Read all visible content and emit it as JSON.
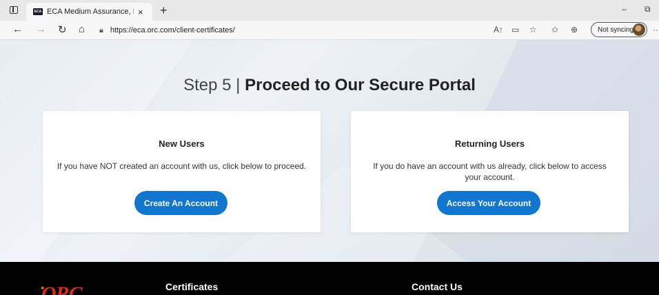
{
  "browser": {
    "tab_title": "ECA Medium Assurance, ECA Me",
    "favicon_text": "ECA",
    "tab_close": "×",
    "new_tab": "+",
    "minimize": "–",
    "restore": "⧉",
    "url": "https://eca.orc.com/client-certificates/",
    "sync_label": "Not syncing",
    "more": "···"
  },
  "page": {
    "step_prefix": "Step 5 | ",
    "step_title": "Proceed to Our Secure Portal",
    "new_users": {
      "title": "New Users",
      "text": "If you have NOT created an account with us, click below to proceed.",
      "button": "Create An Account"
    },
    "returning_users": {
      "title": "Returning Users",
      "text": "If you do have an account with us already, click below to access your account.",
      "button": "Access Your Account"
    }
  },
  "footer": {
    "logo_text": "ORC",
    "certificates_heading": "Certificates",
    "contact_heading": "Contact Us"
  },
  "colors": {
    "accent": "#1176cf",
    "footer_bg": "#000000",
    "logo_red": "#d62b1e"
  }
}
